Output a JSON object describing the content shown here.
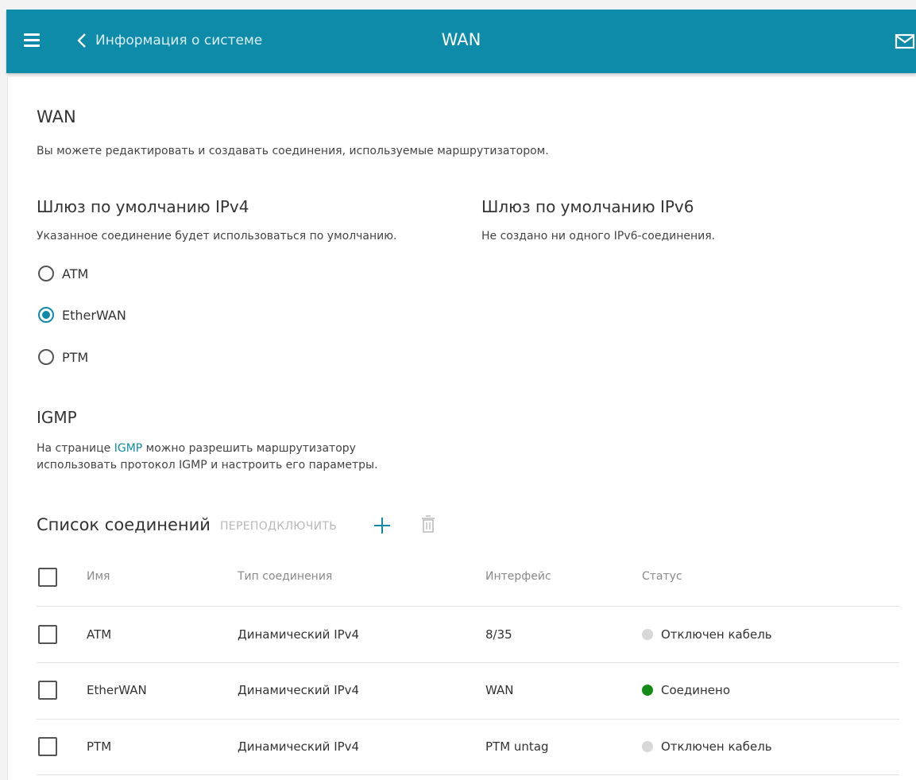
{
  "header": {
    "back_label": "Информация о системе",
    "title": "WAN",
    "bg_color": "#0e8ba8"
  },
  "page": {
    "title": "WAN",
    "description": "Вы можете редактировать и создавать соединения, используемые маршрутизатором."
  },
  "ipv4": {
    "title": "Шлюз по умолчанию IPv4",
    "description": "Указанное соединение будет использоваться по умолчанию.",
    "options": [
      {
        "label": "ATM",
        "selected": false
      },
      {
        "label": "EtherWAN",
        "selected": true
      },
      {
        "label": "PTM",
        "selected": false
      }
    ]
  },
  "ipv6": {
    "title": "Шлюз по умолчанию IPv6",
    "description": "Не создано ни одного IPv6-соединения."
  },
  "igmp": {
    "title": "IGMP",
    "text_before": "На странице ",
    "link": "IGMP",
    "text_after": " можно разрешить маршрутизатору",
    "line2": "использовать протокол IGMP и настроить его параметры."
  },
  "connections": {
    "title": "Список соединений",
    "reconnect_label": "ПЕРЕПОДКЛЮЧИТЬ",
    "add_icon": "plus-icon",
    "delete_icon": "trash-icon",
    "columns": [
      "Имя",
      "Тип соединения",
      "Интерфейс",
      "Статус"
    ],
    "rows": [
      {
        "name": "ATM",
        "type": "Динамический IPv4",
        "interface": "8/35",
        "status": "Отключен кабель",
        "status_color": "#d8d8d8"
      },
      {
        "name": "EtherWAN",
        "type": "Динамический IPv4",
        "interface": "WAN",
        "status": "Соединено",
        "status_color": "#168a16"
      },
      {
        "name": "PTM",
        "type": "Динамический IPv4",
        "interface": "PTM untag",
        "status": "Отключен кабель",
        "status_color": "#d8d8d8"
      }
    ]
  }
}
